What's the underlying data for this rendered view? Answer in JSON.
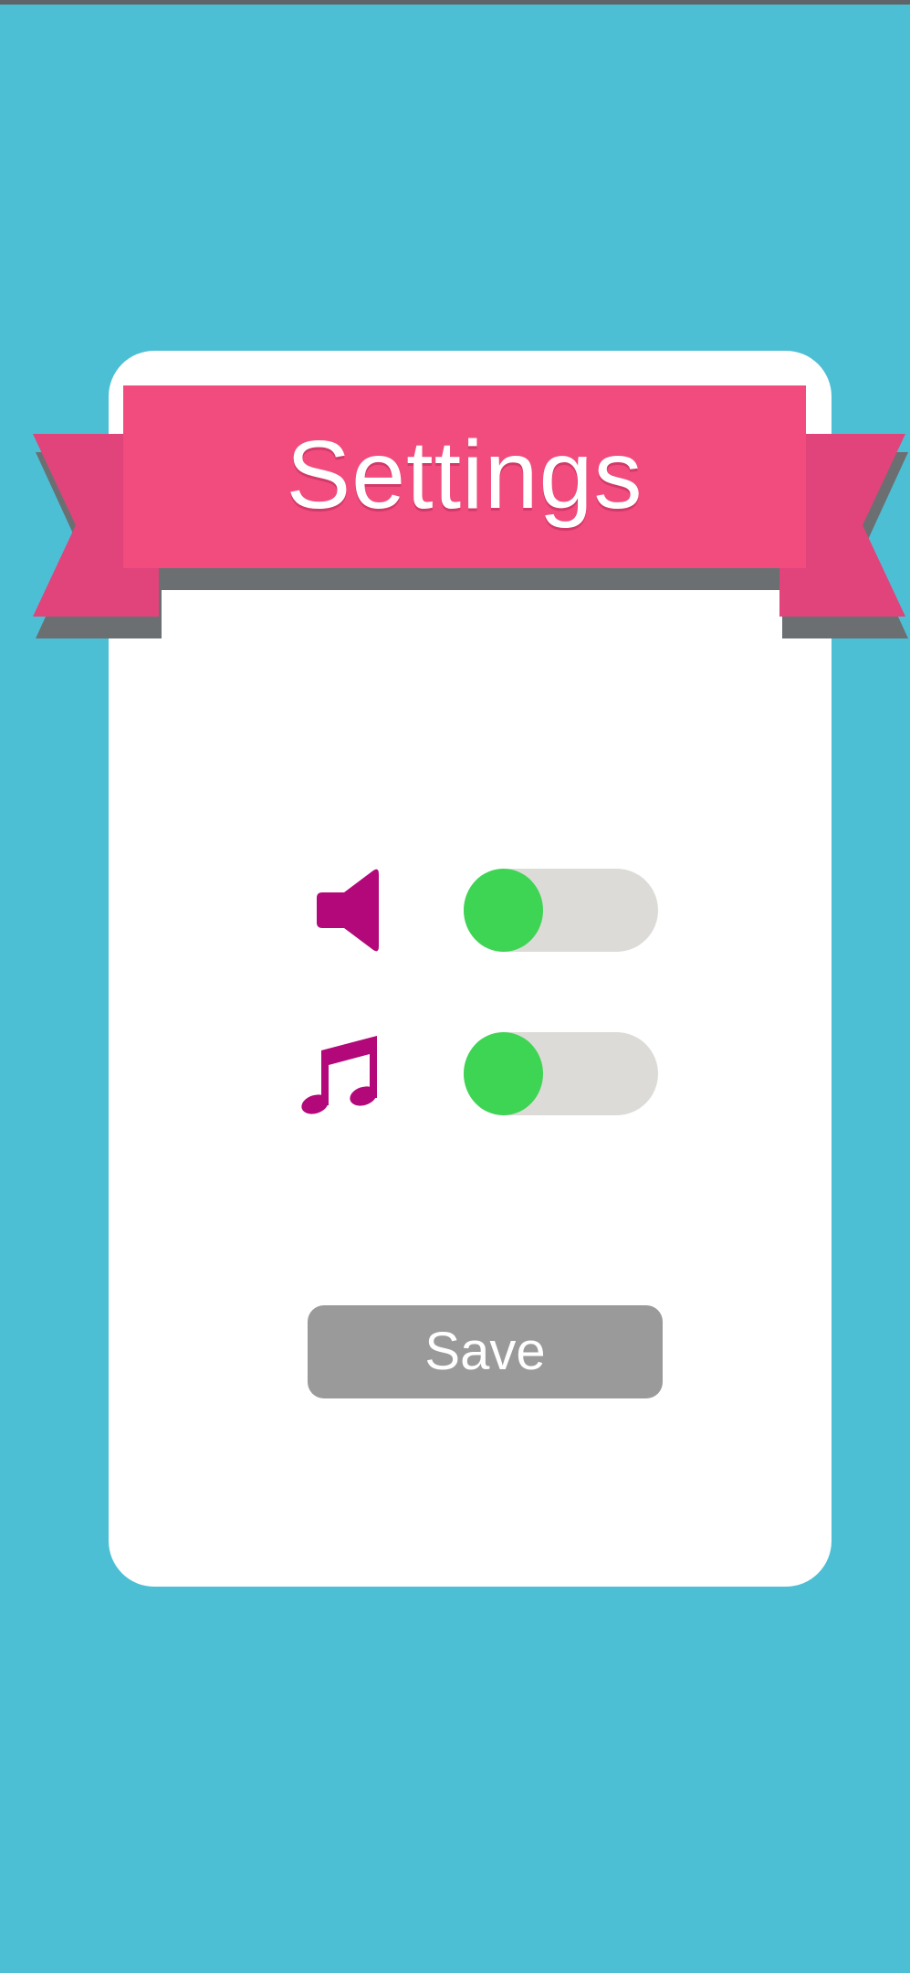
{
  "screen": {
    "title": "Settings",
    "background_color": "#4cbfd5",
    "ribbon_color": "#f24b7e",
    "icon_color": "#b3087a"
  },
  "settings": [
    {
      "icon": "speaker-icon",
      "state": "off",
      "toggle_color": "#3ed454"
    },
    {
      "icon": "music-note-icon",
      "state": "off",
      "toggle_color": "#3ed454"
    }
  ],
  "actions": {
    "save_label": "Save",
    "save_color": "#9a9a9a"
  }
}
